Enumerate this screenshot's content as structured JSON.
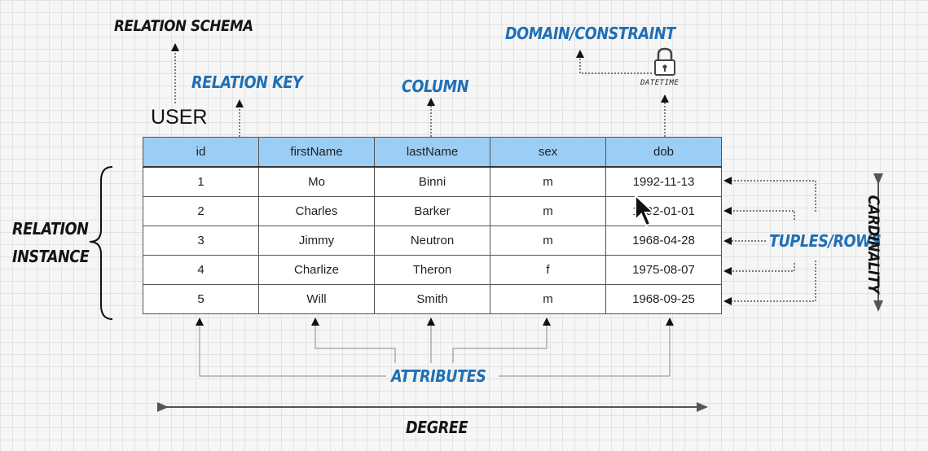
{
  "labels": {
    "relation_schema": "RELATION SCHEMA",
    "relation_key": "RELATION KEY",
    "column": "COLUMN",
    "domain_constraint": "DOMAIN/CONSTRAINT",
    "datetime": "DATETIME",
    "relation_instance_line1": "RELATION",
    "relation_instance_line2": "INSTANCE",
    "tuples_rows": "TUPLES/ROWS",
    "cardinality": "CARDINALITY",
    "attributes": "ATTRIBUTES",
    "degree": "DEGREE"
  },
  "table": {
    "name": "USER",
    "columns": [
      "id",
      "firstName",
      "lastName",
      "sex",
      "dob"
    ],
    "rows": [
      [
        "1",
        "Mo",
        "Binni",
        "m",
        "1992-11-13"
      ],
      [
        "2",
        "Charles",
        "Barker",
        "m",
        "1992-01-01"
      ],
      [
        "3",
        "Jimmy",
        "Neutron",
        "m",
        "1968-04-28"
      ],
      [
        "4",
        "Charlize",
        "Theron",
        "f",
        "1975-08-07"
      ],
      [
        "5",
        "Will",
        "Smith",
        "m",
        "1968-09-25"
      ]
    ]
  },
  "icons": {
    "lock": "lock-icon",
    "cursor": "mouse-pointer-icon"
  },
  "colors": {
    "header_fill": "#9bcdf5",
    "label_blue": "#1f6fb5"
  }
}
